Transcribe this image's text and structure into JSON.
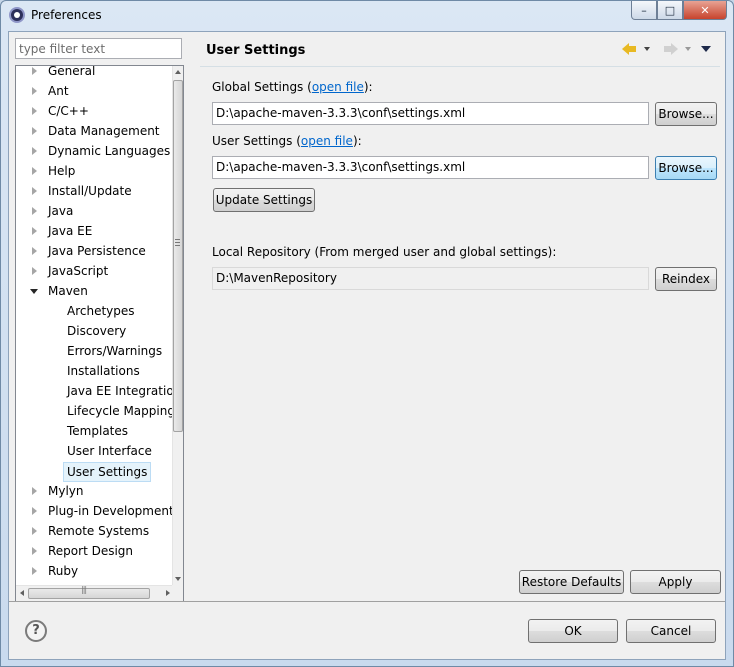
{
  "window": {
    "title": "Preferences",
    "minimize_glyph": "–",
    "maximize_glyph": "□",
    "close_glyph": "✕"
  },
  "filter": {
    "placeholder": "type filter text"
  },
  "tree": {
    "items": [
      {
        "label": "General",
        "level": 0,
        "state": "collapsed"
      },
      {
        "label": "Ant",
        "level": 0,
        "state": "collapsed"
      },
      {
        "label": "C/C++",
        "level": 0,
        "state": "collapsed"
      },
      {
        "label": "Data Management",
        "level": 0,
        "state": "collapsed"
      },
      {
        "label": "Dynamic Languages",
        "level": 0,
        "state": "collapsed"
      },
      {
        "label": "Help",
        "level": 0,
        "state": "collapsed"
      },
      {
        "label": "Install/Update",
        "level": 0,
        "state": "collapsed"
      },
      {
        "label": "Java",
        "level": 0,
        "state": "collapsed"
      },
      {
        "label": "Java EE",
        "level": 0,
        "state": "collapsed"
      },
      {
        "label": "Java Persistence",
        "level": 0,
        "state": "collapsed"
      },
      {
        "label": "JavaScript",
        "level": 0,
        "state": "collapsed"
      },
      {
        "label": "Maven",
        "level": 0,
        "state": "expanded"
      },
      {
        "label": "Archetypes",
        "level": 1,
        "state": "leaf"
      },
      {
        "label": "Discovery",
        "level": 1,
        "state": "leaf"
      },
      {
        "label": "Errors/Warnings",
        "level": 1,
        "state": "leaf"
      },
      {
        "label": "Installations",
        "level": 1,
        "state": "leaf"
      },
      {
        "label": "Java EE Integration",
        "level": 1,
        "state": "leaf"
      },
      {
        "label": "Lifecycle Mapping",
        "level": 1,
        "state": "leaf"
      },
      {
        "label": "Templates",
        "level": 1,
        "state": "leaf"
      },
      {
        "label": "User Interface",
        "level": 1,
        "state": "leaf"
      },
      {
        "label": "User Settings",
        "level": 1,
        "state": "leaf",
        "selected": true
      },
      {
        "label": "Mylyn",
        "level": 0,
        "state": "collapsed"
      },
      {
        "label": "Plug-in Development",
        "level": 0,
        "state": "collapsed"
      },
      {
        "label": "Remote Systems",
        "level": 0,
        "state": "collapsed"
      },
      {
        "label": "Report Design",
        "level": 0,
        "state": "collapsed"
      },
      {
        "label": "Ruby",
        "level": 0,
        "state": "collapsed"
      }
    ]
  },
  "page": {
    "title": "User Settings",
    "global_settings": {
      "label_prefix": "Global Settings (",
      "link": "open file",
      "label_suffix": "):",
      "value": "D:\\apache-maven-3.3.3\\conf\\settings.xml",
      "browse_label": "Browse..."
    },
    "user_settings": {
      "label_prefix": "User Settings (",
      "link": "open file",
      "label_suffix": "):",
      "value": "D:\\apache-maven-3.3.3\\conf\\settings.xml",
      "browse_label": "Browse..."
    },
    "update_settings_label": "Update Settings",
    "local_repo": {
      "label": "Local Repository (From merged user and global settings):",
      "value": "D:\\MavenRepository",
      "reindex_label": "Reindex"
    },
    "restore_defaults_label": "Restore Defaults",
    "apply_label": "Apply"
  },
  "footer": {
    "help_glyph": "?",
    "ok_label": "OK",
    "cancel_label": "Cancel"
  },
  "colors": {
    "link": "#0066cc",
    "nav_back": "#e8b923",
    "selection_bg": "#e5f3fb"
  }
}
